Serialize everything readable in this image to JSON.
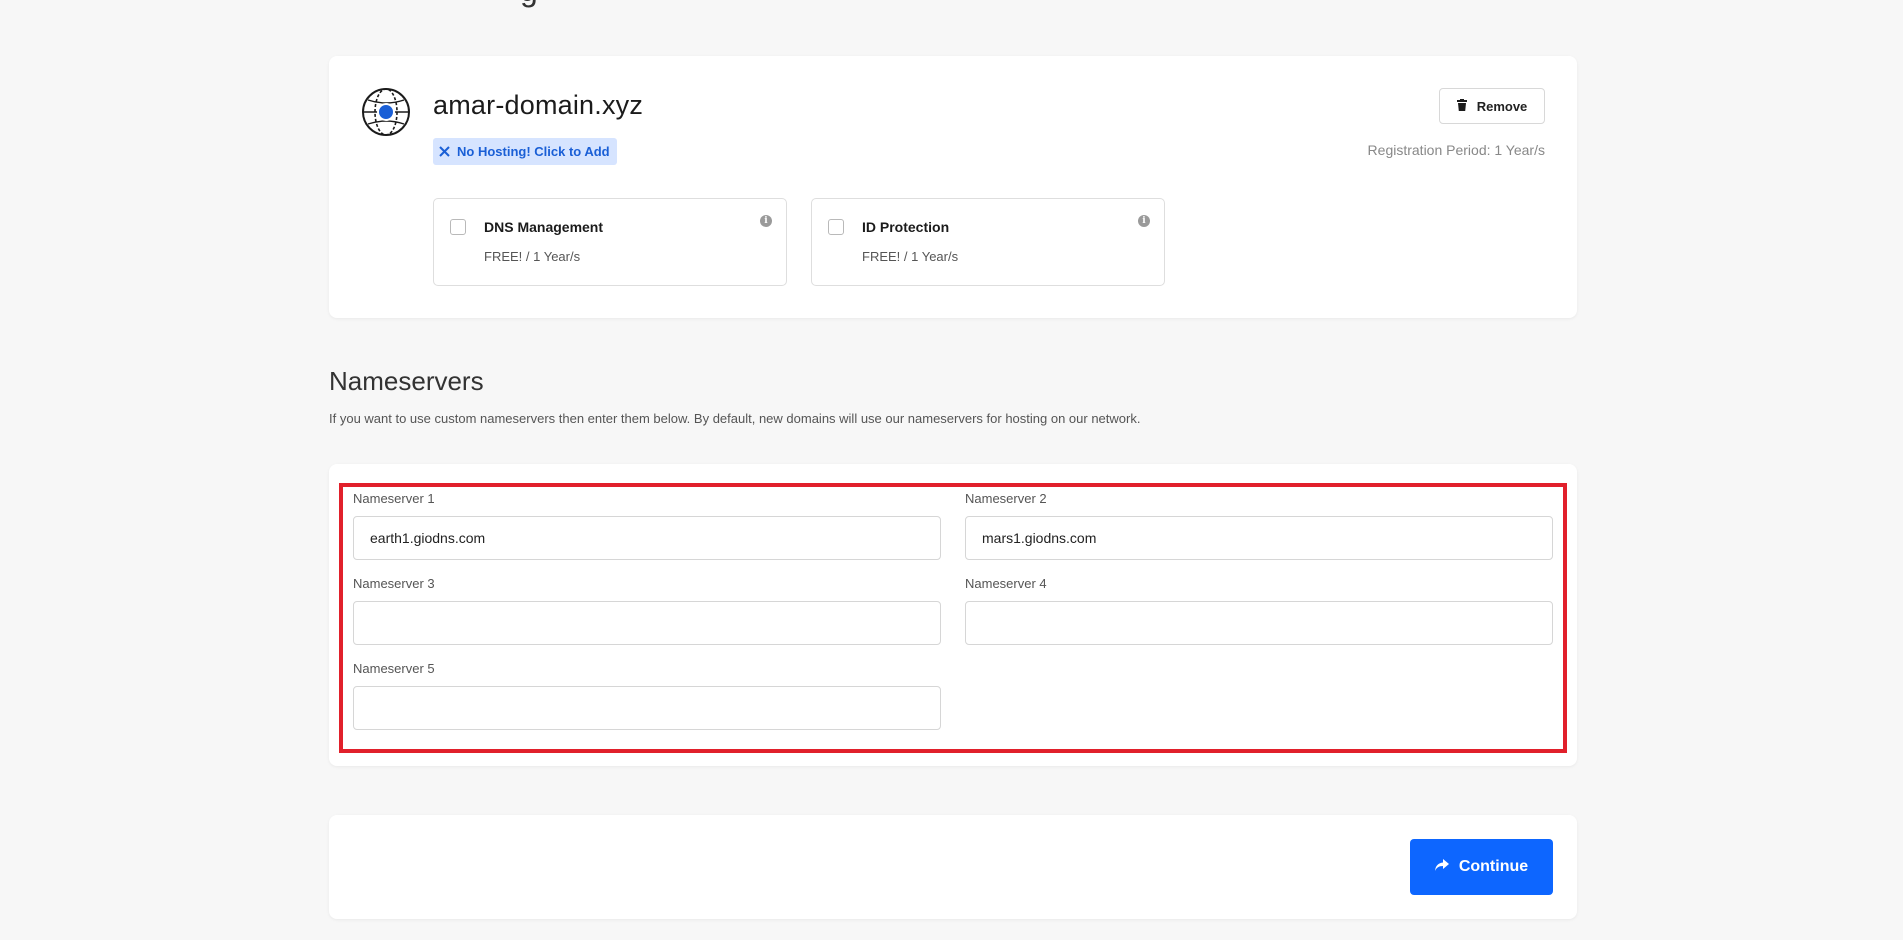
{
  "page": {
    "title_fragment": "g"
  },
  "domain": {
    "name": "amar-domain.xyz",
    "hosting_badge_label": "No Hosting! Click to Add",
    "remove_label": "Remove",
    "registration_period": "Registration Period: 1 Year/s",
    "addons": [
      {
        "title": "DNS Management",
        "price": "FREE! / 1 Year/s",
        "checked": false
      },
      {
        "title": "ID Protection",
        "price": "FREE! / 1 Year/s",
        "checked": false
      }
    ]
  },
  "nameservers": {
    "heading": "Nameservers",
    "description": "If you want to use custom nameservers then enter them below. By default, new domains will use our nameservers for hosting on our network.",
    "fields": [
      {
        "label": "Nameserver 1",
        "value": "earth1.giodns.com"
      },
      {
        "label": "Nameserver 2",
        "value": "mars1.giodns.com"
      },
      {
        "label": "Nameserver 3",
        "value": ""
      },
      {
        "label": "Nameserver 4",
        "value": ""
      },
      {
        "label": "Nameserver 5",
        "value": ""
      }
    ]
  },
  "footer": {
    "continue_label": "Continue"
  },
  "colors": {
    "accent": "#0d66ff",
    "highlight_border": "#e1202b",
    "badge_bg": "#d6e4ff"
  },
  "icons": {
    "domain": "globe-icon",
    "remove": "trash-icon",
    "badge": "close-icon",
    "info": "info-icon",
    "continue": "share-arrow-icon"
  }
}
